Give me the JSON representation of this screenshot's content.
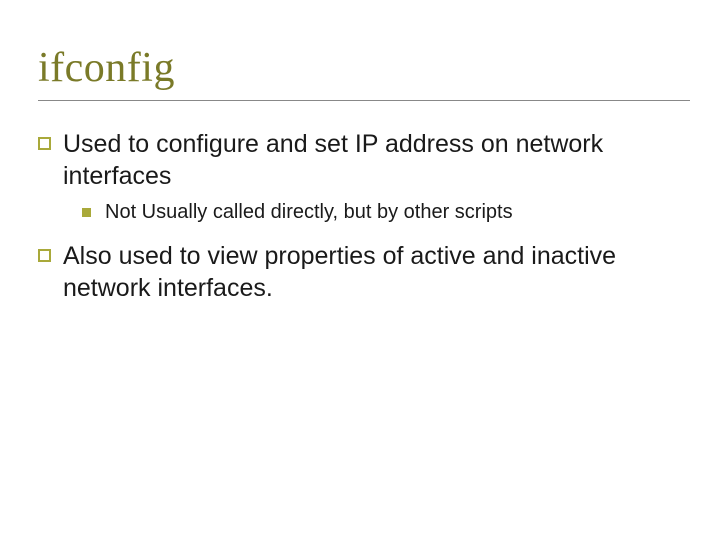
{
  "slide": {
    "title": "ifconfig",
    "bullets": [
      {
        "text": "Used to configure and set IP address on network interfaces",
        "sub": [
          {
            "text": "Not Usually called directly, but by other scripts"
          }
        ]
      },
      {
        "text": "Also used to view properties of active and inactive network interfaces."
      }
    ]
  }
}
